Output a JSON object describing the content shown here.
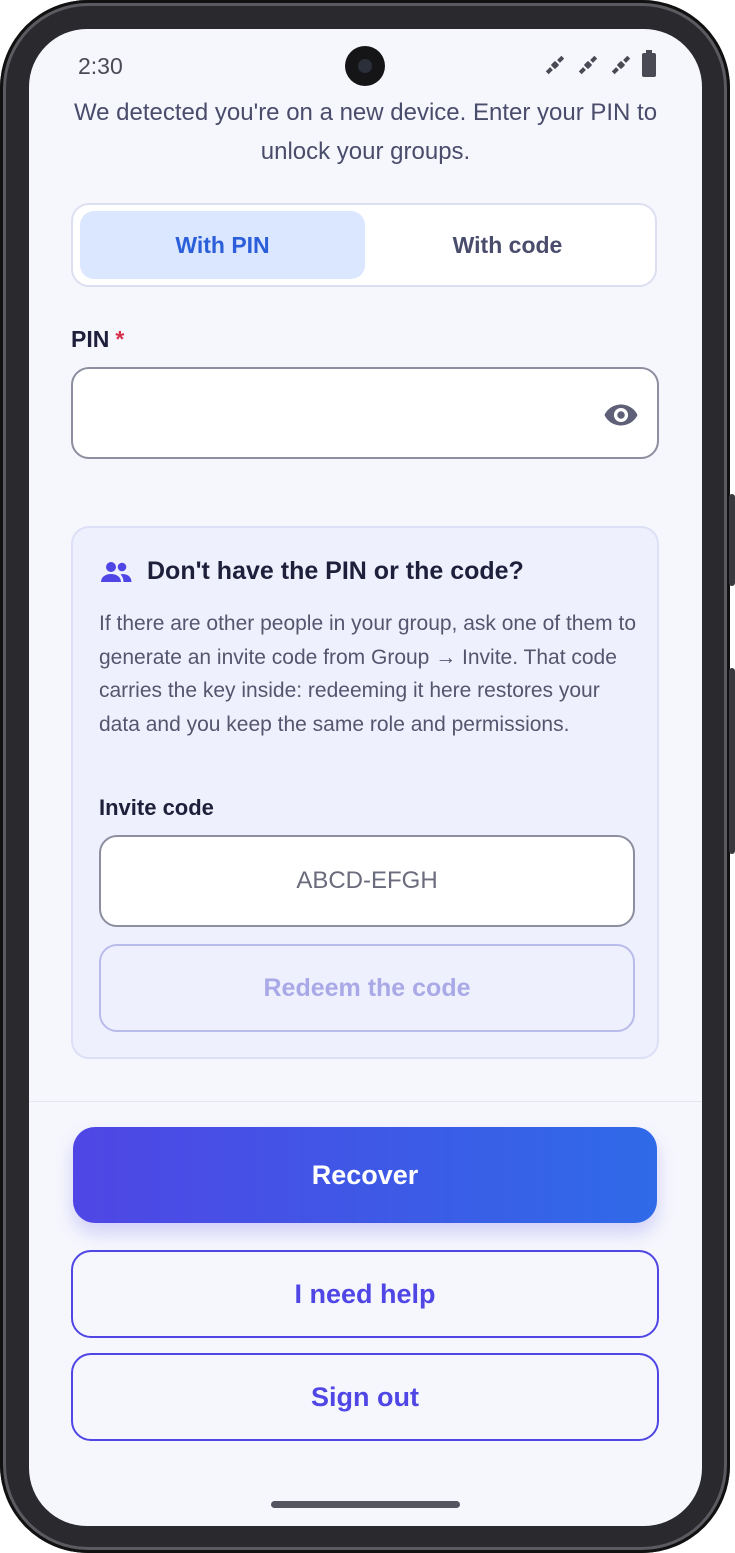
{
  "status_bar": {
    "time": "2:30",
    "icons": [
      "satellite-icon",
      "satellite-icon",
      "satellite-icon",
      "battery-icon"
    ]
  },
  "intro_text": "We detected you're on a new device. Enter your PIN to unlock your groups.",
  "method_tabs": {
    "pin_label": "With PIN",
    "code_label": "With code",
    "selected": "With PIN"
  },
  "pin_field": {
    "label": "PIN",
    "required_mark": "*",
    "value": "",
    "visibility_icon": "eye-icon"
  },
  "help_card": {
    "icon": "group-icon",
    "title": "Don't have the PIN or the code?",
    "body": "If there are other people in your group, ask one of them to generate an invite code from Group → Invite. That code carries the key inside: redeeming it here restores your data and you keep the same role and permissions.",
    "invite_label": "Invite code",
    "invite_placeholder": "ABCD-EFGH",
    "invite_value": "",
    "redeem_label": "Redeem the code"
  },
  "actions": {
    "recover_label": "Recover",
    "help_label": "I need help",
    "signout_label": "Sign out"
  },
  "colors": {
    "accent": "#4f46e5",
    "accent_end": "#2f6ae8",
    "tab_selected_bg": "#dbe7ff",
    "tab_selected_text": "#2b5fd9",
    "required": "#d6314b",
    "card_bg": "#eff0fd"
  }
}
